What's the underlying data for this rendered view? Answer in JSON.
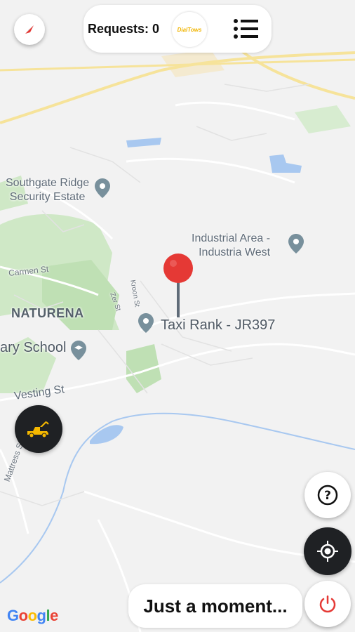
{
  "header": {
    "requests_label": "Requests: 0",
    "logo_text": "DialTows"
  },
  "map": {
    "labels": {
      "southgate": "Southgate Ridge\nSecurity Estate",
      "industrial": "Industrial Area -\nIndustria West",
      "carmen": "Carmen St",
      "naturena": "NATURENA",
      "taxi_rank": "Taxi Rank - JR397",
      "school": "ary School",
      "vesting": "Vesting St",
      "mattress": "Mattress St",
      "zeritsanda": "Zer St",
      "kroon": "Kroon St"
    },
    "attribution": "Google"
  },
  "toast": {
    "text": "Just a moment..."
  },
  "buttons": {
    "help_symbol": "?"
  },
  "colors": {
    "pin": "#e53935",
    "tow_truck": "#f5b800",
    "power": "#e53935",
    "dark_button": "#1f2124"
  }
}
